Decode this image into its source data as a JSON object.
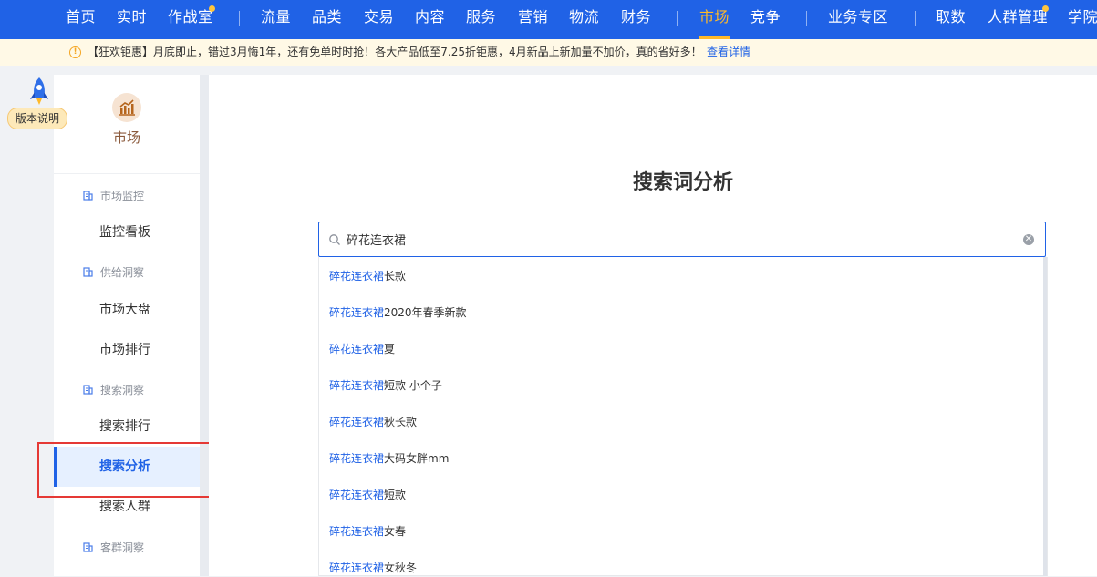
{
  "topnav": {
    "items": [
      "首页",
      "实时",
      "作战室",
      "流量",
      "品类",
      "交易",
      "内容",
      "服务",
      "营销",
      "物流",
      "财务",
      "市场",
      "竞争",
      "业务专区",
      "取数",
      "人群管理",
      "学院"
    ],
    "active": "市场"
  },
  "notice": {
    "icon": "info-icon",
    "text": "【狂欢钜惠】月底即止，错过3月悔1年，还有免单时时抢！各大产品低至7.25折钜惠，4月新品上新加量不加价，真的省好多！",
    "link": "查看详情"
  },
  "version_badge": {
    "label": "版本说明",
    "icon": "rocket-icon"
  },
  "sidebar": {
    "section_title": "市场",
    "section_icon": "market-icon",
    "groups": [
      {
        "label": "市场监控",
        "items": [
          "监控看板"
        ]
      },
      {
        "label": "供给洞察",
        "items": [
          "市场大盘",
          "市场排行"
        ]
      },
      {
        "label": "搜索洞察",
        "items": [
          "搜索排行",
          "搜索分析",
          "搜索人群"
        ]
      },
      {
        "label": "客群洞察",
        "items": []
      }
    ],
    "selected": "搜索分析"
  },
  "main": {
    "title": "搜索词分析",
    "search": {
      "value": "碎花连衣裙",
      "placeholder": ""
    },
    "suggestions": [
      {
        "keyword": "碎花连衣裙",
        "suffix": "长款"
      },
      {
        "keyword": "碎花连衣裙",
        "suffix": "2020年春季新款"
      },
      {
        "keyword": "碎花连衣裙",
        "suffix": "夏"
      },
      {
        "keyword": "碎花连衣裙",
        "suffix": "短款 小个子"
      },
      {
        "keyword": "碎花连衣裙",
        "suffix": "秋长款"
      },
      {
        "keyword": "碎花连衣裙",
        "suffix": "大码女胖mm"
      },
      {
        "keyword": "碎花连衣裙",
        "suffix": "短款"
      },
      {
        "keyword": "碎花连衣裙",
        "suffix": "女春"
      },
      {
        "keyword": "碎花连衣裙",
        "suffix": "女秋冬"
      }
    ]
  },
  "colors": {
    "brand": "#2062e6",
    "active_nav": "#ffb928",
    "highlight_box": "#e53935"
  }
}
